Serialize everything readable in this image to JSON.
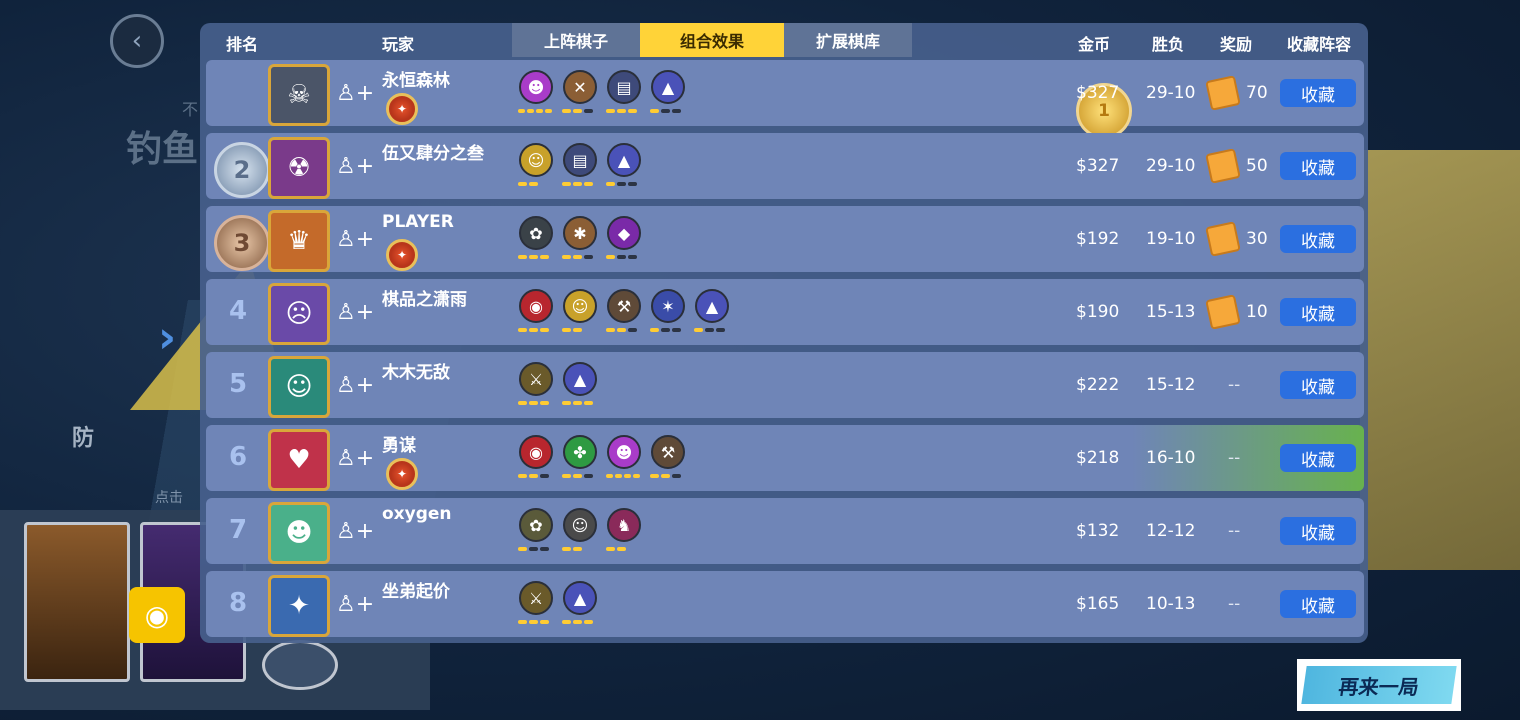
{
  "background": {
    "title": "钓鱼",
    "subtitle": "不",
    "defense_label": "防",
    "click_hint": "点击"
  },
  "header": {
    "rank": "排名",
    "player": "玩家",
    "tabs": [
      {
        "label": "上阵棋子",
        "active": false
      },
      {
        "label": "组合效果",
        "active": true
      },
      {
        "label": "扩展棋库",
        "active": false
      }
    ],
    "gold": "金币",
    "record": "胜负",
    "reward": "奖励",
    "collect": "收藏阵容"
  },
  "rows": [
    {
      "rank": "1",
      "medal": "gold",
      "name": "永恒森林",
      "has_rank_badge": true,
      "gold": "$327",
      "record": "29-10",
      "reward": "70",
      "collect": "收藏",
      "synergies": [
        {
          "color": "#a93cc9",
          "icon": "☻",
          "bars": [
            1,
            1,
            1,
            1
          ]
        },
        {
          "color": "#8b5e35",
          "icon": "✕",
          "bars": [
            1,
            1,
            0
          ]
        },
        {
          "color": "#3e4a7a",
          "icon": "▤",
          "bars": [
            1,
            1,
            1
          ]
        },
        {
          "color": "#4a52b8",
          "icon": "▲",
          "bars": [
            1,
            0,
            0
          ]
        }
      ]
    },
    {
      "rank": "2",
      "medal": "silver",
      "name": "伍又肆分之叁",
      "has_rank_badge": false,
      "gold": "$327",
      "record": "29-10",
      "reward": "50",
      "collect": "收藏",
      "synergies": [
        {
          "color": "#c8a12a",
          "icon": "☺",
          "bars": [
            1,
            1
          ]
        },
        {
          "color": "#3e4a7a",
          "icon": "▤",
          "bars": [
            1,
            1,
            1
          ]
        },
        {
          "color": "#4a52b8",
          "icon": "▲",
          "bars": [
            1,
            0,
            0
          ]
        }
      ]
    },
    {
      "rank": "3",
      "medal": "bronze",
      "name": "PLAYER",
      "has_rank_badge": true,
      "gold": "$192",
      "record": "19-10",
      "reward": "30",
      "collect": "收藏",
      "synergies": [
        {
          "color": "#3a4248",
          "icon": "✿",
          "bars": [
            1,
            1,
            1
          ]
        },
        {
          "color": "#8b5e35",
          "icon": "✱",
          "bars": [
            1,
            1,
            0
          ]
        },
        {
          "color": "#7a2aa8",
          "icon": "◆",
          "bars": [
            1,
            0,
            0
          ]
        }
      ]
    },
    {
      "rank": "4",
      "medal": "",
      "name": "棋品之潇雨",
      "has_rank_badge": false,
      "gold": "$190",
      "record": "15-13",
      "reward": "10",
      "collect": "收藏",
      "synergies": [
        {
          "color": "#b8262e",
          "icon": "◉",
          "bars": [
            1,
            1,
            1
          ]
        },
        {
          "color": "#c8a12a",
          "icon": "☺",
          "bars": [
            1,
            1
          ]
        },
        {
          "color": "#5f4a38",
          "icon": "⚒",
          "bars": [
            1,
            1,
            0
          ]
        },
        {
          "color": "#3a4ca8",
          "icon": "✶",
          "bars": [
            1,
            0,
            0
          ]
        },
        {
          "color": "#4a52b8",
          "icon": "▲",
          "bars": [
            1,
            0,
            0
          ]
        }
      ]
    },
    {
      "rank": "5",
      "medal": "",
      "name": "木木无敌",
      "has_rank_badge": false,
      "gold": "$222",
      "record": "15-12",
      "reward": "--",
      "collect": "收藏",
      "synergies": [
        {
          "color": "#6a5a2a",
          "icon": "⚔",
          "bars": [
            1,
            1,
            1
          ]
        },
        {
          "color": "#4a52b8",
          "icon": "▲",
          "bars": [
            1,
            1,
            1
          ]
        }
      ]
    },
    {
      "rank": "6",
      "medal": "",
      "name": "勇谋",
      "has_rank_badge": true,
      "me": true,
      "gold": "$218",
      "record": "16-10",
      "reward": "--",
      "collect": "收藏",
      "synergies": [
        {
          "color": "#b8262e",
          "icon": "◉",
          "bars": [
            1,
            1,
            0
          ]
        },
        {
          "color": "#2e9a42",
          "icon": "✤",
          "bars": [
            1,
            1,
            0
          ]
        },
        {
          "color": "#a93cc9",
          "icon": "☻",
          "bars": [
            1,
            1,
            1,
            1
          ]
        },
        {
          "color": "#5f4a38",
          "icon": "⚒",
          "bars": [
            1,
            1,
            0
          ]
        }
      ]
    },
    {
      "rank": "7",
      "medal": "",
      "name": "oxygen",
      "has_rank_badge": false,
      "gold": "$132",
      "record": "12-12",
      "reward": "--",
      "collect": "收藏",
      "synergies": [
        {
          "color": "#5a5a3a",
          "icon": "✿",
          "bars": [
            1,
            0,
            0
          ]
        },
        {
          "color": "#4a4a4a",
          "icon": "☺",
          "bars": [
            1,
            1
          ]
        },
        {
          "color": "#8a2a5a",
          "icon": "♞",
          "bars": [
            1,
            1
          ]
        }
      ]
    },
    {
      "rank": "8",
      "medal": "",
      "name": "坐弟起价",
      "has_rank_badge": false,
      "gold": "$165",
      "record": "10-13",
      "reward": "--",
      "collect": "收藏",
      "synergies": [
        {
          "color": "#6a5a2a",
          "icon": "⚔",
          "bars": [
            1,
            1,
            1
          ]
        },
        {
          "color": "#4a52b8",
          "icon": "▲",
          "bars": [
            1,
            1,
            1
          ]
        }
      ]
    }
  ],
  "avatars": [
    "☠",
    "☢",
    "♛",
    "☹",
    "☺",
    "♥",
    "☻",
    "✦"
  ],
  "play_again": "再来一局"
}
